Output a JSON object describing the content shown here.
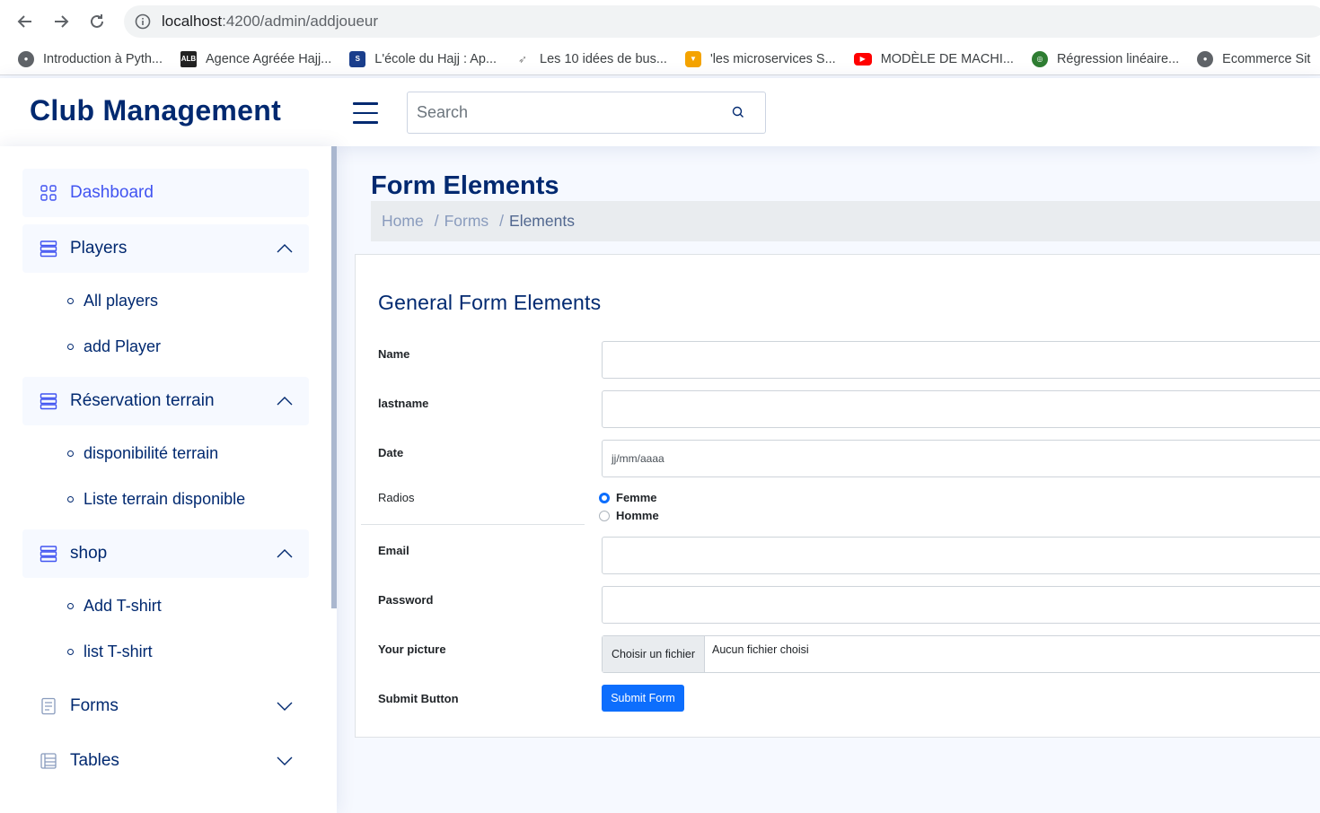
{
  "browser": {
    "url_host": "localhost",
    "url_path": ":4200/admin/addjoueur",
    "bookmarks": [
      {
        "label": "Introduction à Pyth...",
        "icon": "globe-icon",
        "color": "#5f6368"
      },
      {
        "label": "Agence Agréée Hajj...",
        "icon": "alb-logo-icon",
        "color": "#222222"
      },
      {
        "label": "L'école du Hajj : Ap...",
        "icon": "school-logo-icon",
        "color": "#1a3e8c"
      },
      {
        "label": "Les 10 idées de bus...",
        "icon": "arrow-logo-icon",
        "color": "#888888"
      },
      {
        "label": "'les microservices S...",
        "icon": "drop-logo-icon",
        "color": "#f4a300"
      },
      {
        "label": "MODÈLE DE MACHI...",
        "icon": "youtube-icon",
        "color": "#ff0000"
      },
      {
        "label": "Régression linéaire...",
        "icon": "green-logo-icon",
        "color": "#2e7d32"
      },
      {
        "label": "Ecommerce Sit",
        "icon": "globe-icon",
        "color": "#5f6368"
      }
    ]
  },
  "header": {
    "logo": "Club Management",
    "search_placeholder": "Search"
  },
  "sidebar": {
    "dashboard": "Dashboard",
    "players": "Players",
    "players_items": [
      "All players",
      "add Player"
    ],
    "reservation": "Réservation terrain",
    "reservation_items": [
      "disponibilité terrain",
      "Liste terrain disponible"
    ],
    "shop": "shop",
    "shop_items": [
      "Add T-shirt",
      "list T-shirt"
    ],
    "forms": "Forms",
    "tables": "Tables"
  },
  "main": {
    "title": "Form Elements",
    "breadcrumb": [
      "Home",
      "Forms",
      "Elements"
    ],
    "card_title": "General Form Elements",
    "labels": {
      "name": "Name",
      "lastname": "lastname",
      "date": "Date",
      "radios": "Radios",
      "email": "Email",
      "password": "Password",
      "picture": "Your picture",
      "submit": "Submit Button"
    },
    "date_placeholder": "jj/mm/aaaa",
    "radio_options": [
      "Femme",
      "Homme"
    ],
    "radio_selected": "Femme",
    "file_button": "Choisir un fichier",
    "file_status": "Aucun fichier choisi",
    "submit_label": "Submit Form"
  },
  "colors": {
    "brand": "#012970",
    "accent": "#4154f1",
    "primary_button": "#0d6efd"
  }
}
